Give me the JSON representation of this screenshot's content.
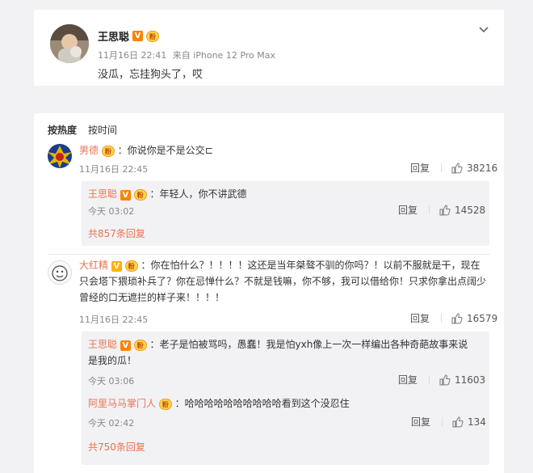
{
  "post": {
    "username": "王思聪",
    "badge_v": "V",
    "badge_fan": "铁粉",
    "time": "11月16日 22:41",
    "source": "来自 iPhone 12 Pro Max",
    "text": "没瓜，忘挂狗头了，哎"
  },
  "tabs": [
    "按热度",
    "按时间"
  ],
  "comments": [
    {
      "user": "男德",
      "text": "：你说你是不是公交",
      "text_tail": "⊏",
      "time": "11月16日 22:45",
      "reply_label": "回复",
      "likes": "38216",
      "replies": [
        {
          "user": "王思聪",
          "text": "：年轻人，你不讲武德",
          "time": "今天 03:02",
          "reply_label": "回复",
          "likes": "14528"
        }
      ],
      "more": "共857条回复"
    },
    {
      "user": "大红精",
      "text": "：你在怕什么？！！！！这还是当年桀骜不驯的你吗？！以前不服就是干，现在只会塔下猥琐补兵了？你在忌惮什么？不就是钱嘛，你不够，我可以借给你！只求你拿出点阔少曾经的口无遮拦的样子来！！！！",
      "time": "11月16日 22:45",
      "reply_label": "回复",
      "likes": "16579",
      "replies": [
        {
          "user": "王思聪",
          "text": "：老子是怕被骂吗，愚蠢！我是怕yxh像上一次一样编出各种奇葩故事来说是我的瓜！",
          "time": "今天 03:06",
          "reply_label": "回复",
          "likes": "11603"
        },
        {
          "user": "阿里马马掌门人",
          "text": "：哈哈哈哈哈哈哈哈哈哈看到这个没忍住",
          "time": "今天 02:42",
          "reply_label": "回复",
          "likes": "134"
        }
      ],
      "more": "共750条回复"
    }
  ],
  "colors": {
    "username": "#eb7350",
    "badge_v": "#ff8200",
    "background": "#f2f2f5"
  }
}
